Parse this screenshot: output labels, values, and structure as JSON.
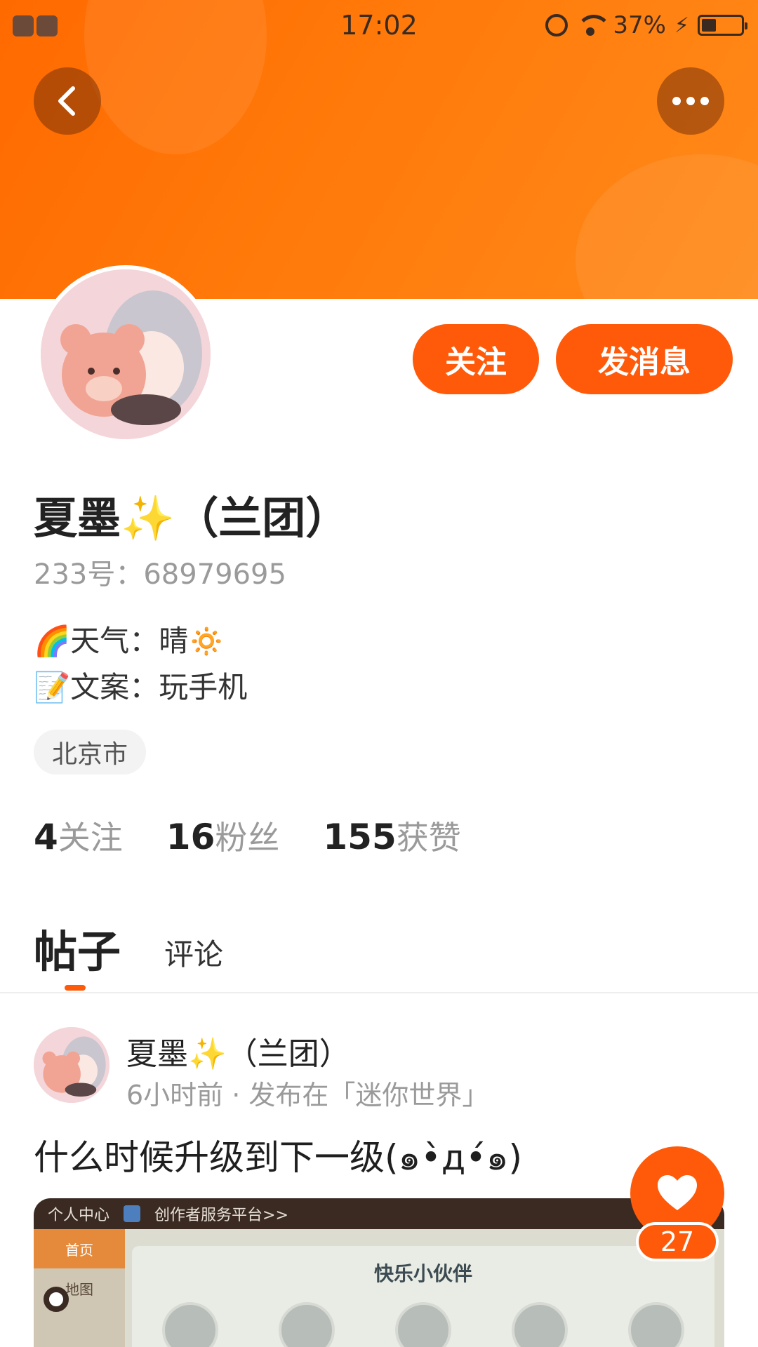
{
  "status_bar": {
    "time": "17:02",
    "battery_percent": "37%",
    "charging_icon": "bolt-icon",
    "icons": [
      "alarm-icon",
      "wifi-icon",
      "battery-icon"
    ]
  },
  "header": {
    "back_icon": "chevron-left-icon",
    "more_icon": "more-dots-icon",
    "accent_color": "#ff6a00"
  },
  "profile": {
    "name": "夏墨✨（兰团）",
    "id_text": "233号：68979695",
    "bio_lines": [
      "🌈天气：晴🔅",
      "📝文案：玩手机"
    ],
    "location": "北京市",
    "follow_button": "关注",
    "message_button": "发消息",
    "stats": [
      {
        "num": "4",
        "label": "关注"
      },
      {
        "num": "16",
        "label": "粉丝"
      },
      {
        "num": "155",
        "label": "获赞"
      }
    ]
  },
  "tabs": [
    {
      "label": "帖子",
      "active": true
    },
    {
      "label": "评论",
      "active": false
    }
  ],
  "post": {
    "author": "夏墨✨（兰团）",
    "meta": "6小时前 · 发布在「迷你世界」",
    "text": "什么时候升级到下一级(๑•̀д•́๑)",
    "like_count": "27",
    "image": {
      "top_tab": "个人中心",
      "top_link": "创作者服务平台>>",
      "side_items": [
        "首页",
        "地图"
      ],
      "panel_title": "快乐小伙伴"
    }
  }
}
